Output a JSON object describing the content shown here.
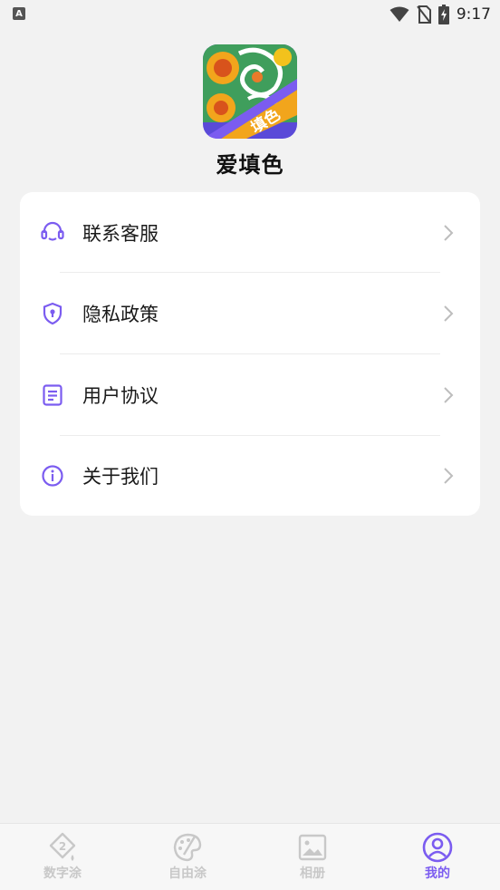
{
  "status_bar": {
    "left_indicator": "A",
    "time": "9:17",
    "icons": [
      "wifi-icon",
      "no-sim-icon",
      "battery-charging-icon"
    ]
  },
  "app": {
    "name": "爱填色",
    "logo_badge": "填色"
  },
  "menu": {
    "items": [
      {
        "label": "联系客服",
        "icon": "headset-icon"
      },
      {
        "label": "隐私政策",
        "icon": "shield-icon"
      },
      {
        "label": "用户协议",
        "icon": "document-icon"
      },
      {
        "label": "关于我们",
        "icon": "info-icon"
      }
    ]
  },
  "bottom_nav": {
    "items": [
      {
        "label": "数字涂",
        "icon": "number-paint-icon",
        "active": false
      },
      {
        "label": "自由涂",
        "icon": "palette-icon",
        "active": false
      },
      {
        "label": "相册",
        "icon": "album-icon",
        "active": false
      },
      {
        "label": "我的",
        "icon": "profile-icon",
        "active": true
      }
    ]
  },
  "colors": {
    "accent": "#7b5cf0",
    "inactive": "#c8c8c8",
    "background": "#f2f2f2",
    "card": "#ffffff"
  }
}
